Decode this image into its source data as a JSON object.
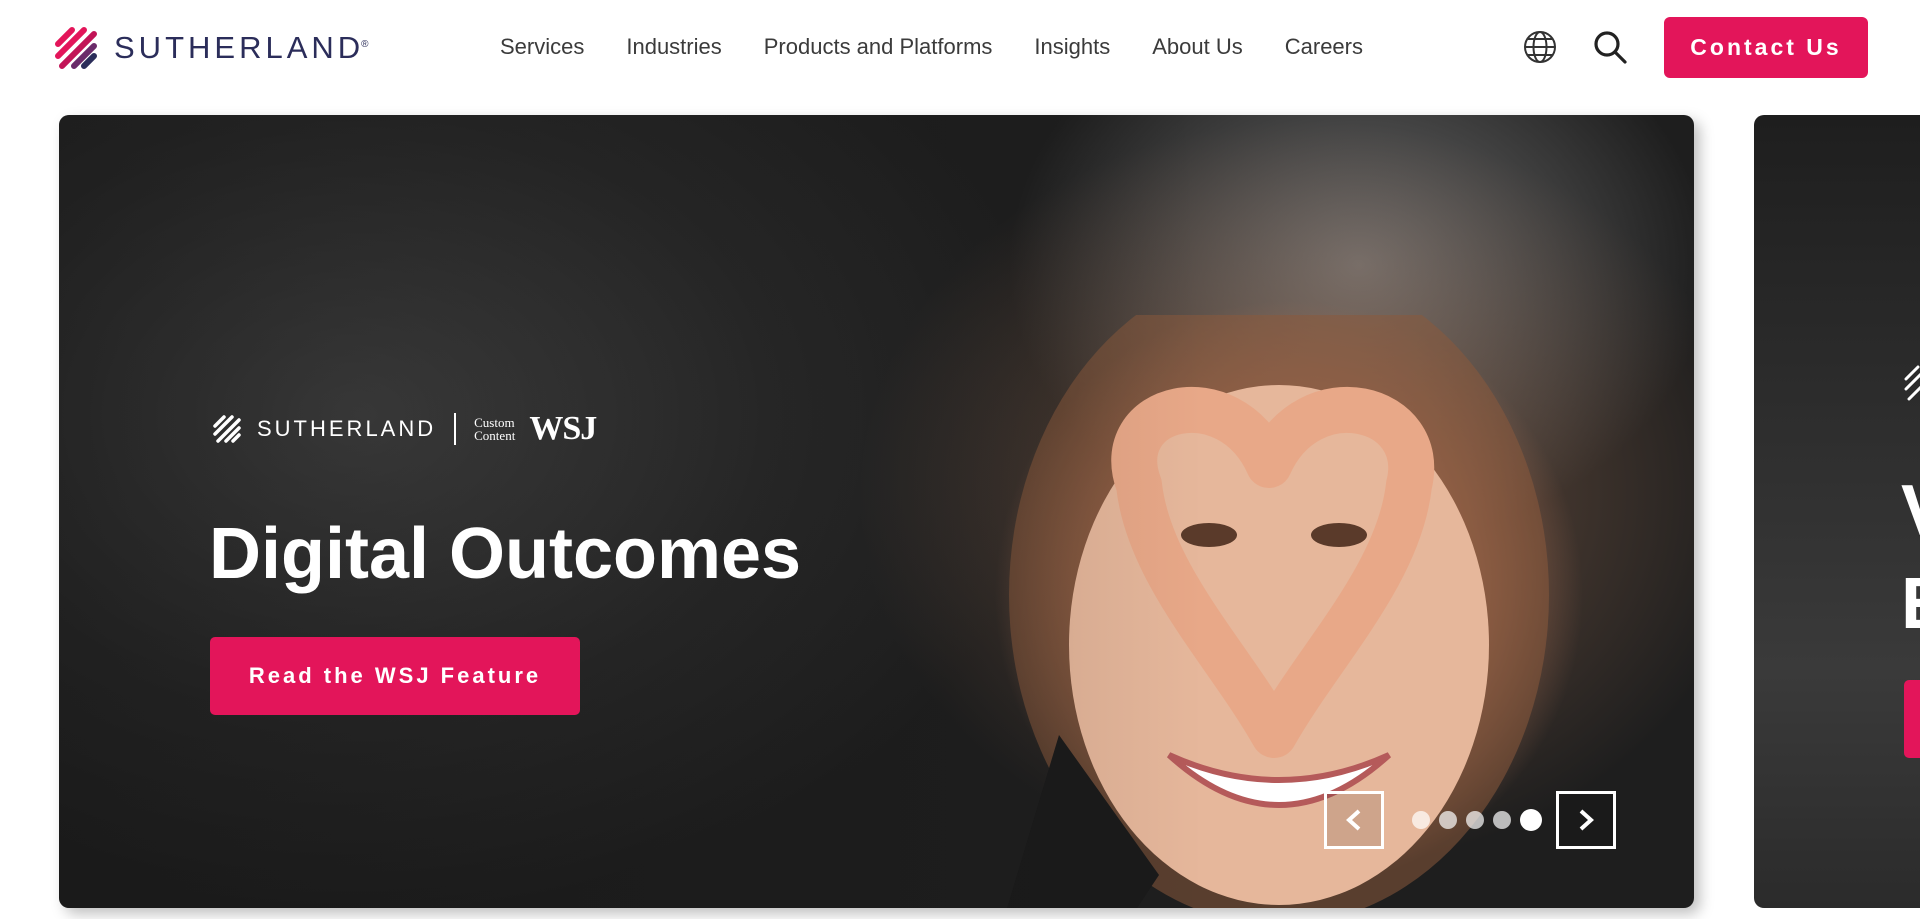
{
  "header": {
    "logo_text": "SUTHERLAND",
    "logo_reg": "®",
    "nav": [
      "Services",
      "Industries",
      "Products and Platforms",
      "Insights",
      "About Us",
      "Careers"
    ],
    "globe_icon": "globe-icon",
    "search_icon": "search-icon",
    "contact_label": "Contact Us"
  },
  "hero": {
    "brand_name": "SUTHERLAND",
    "brand_custom_line1": "Custom",
    "brand_custom_line2": "Content",
    "brand_wsj": "WSJ",
    "title": "Digital Outcomes",
    "cta_label": "Read the WSJ Feature",
    "prev_icon": "chevron-left-icon",
    "next_icon": "chevron-right-icon",
    "slide_count": 5,
    "active_slide": 5
  },
  "peek": {
    "letter_1": "V",
    "letter_2": "E"
  },
  "colors": {
    "accent": "#e3155a",
    "brand_navy": "#2b2d5a"
  }
}
